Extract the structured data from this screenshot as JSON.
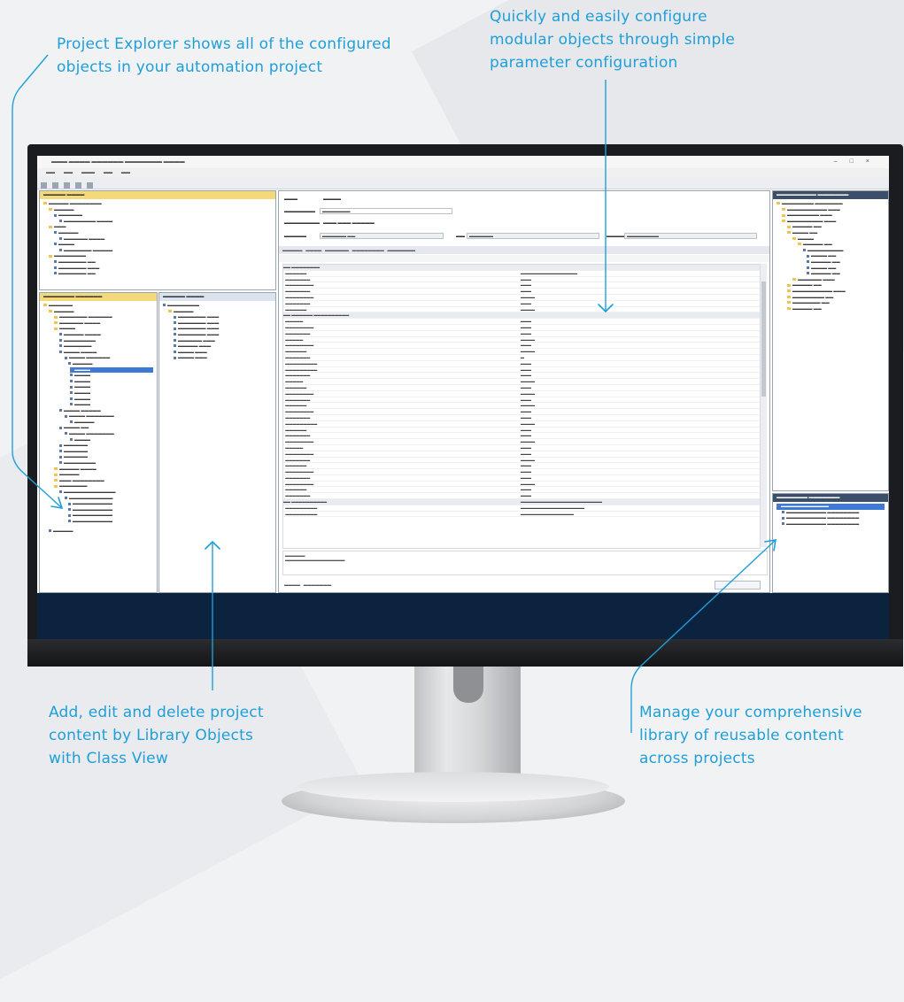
{
  "callouts": {
    "project_explorer": [
      "Project Explorer shows all of the configured",
      "objects in your automation project"
    ],
    "configure": [
      "Quickly and easily configure",
      "modular objects through simple",
      "parameter configuration"
    ],
    "class_view": [
      "Add, edit and delete project",
      "content by Library Objects",
      "with Class View"
    ],
    "library": [
      "Manage your comprehensive",
      "library of reusable content",
      "across projects"
    ]
  },
  "colors": {
    "accent": "#1f9fd8",
    "taskbar": "#0c2340",
    "background": "#f1f2f4"
  }
}
